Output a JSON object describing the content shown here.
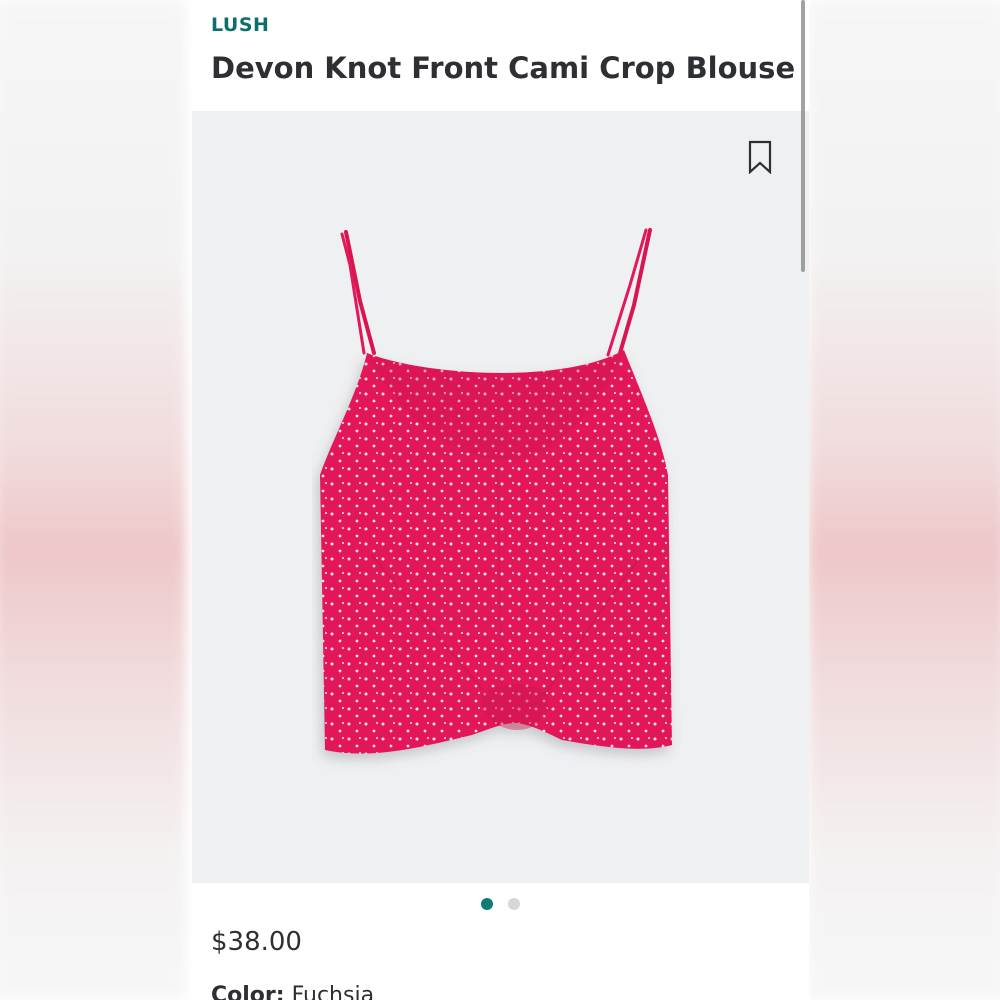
{
  "product": {
    "brand": "LUSH",
    "title": "Devon Knot Front Cami Crop Blouse",
    "price": "$38.00",
    "color_label": "Color:",
    "color_value": "Fuchsia"
  },
  "carousel": {
    "total_images": 2,
    "active_index": 0
  },
  "icons": {
    "bookmark": "bookmark-icon"
  },
  "colors": {
    "brand_accent": "#0e6e6b",
    "active_dot": "#0e7b78",
    "garment": "#e3175a",
    "image_background": "#eff0f2"
  }
}
